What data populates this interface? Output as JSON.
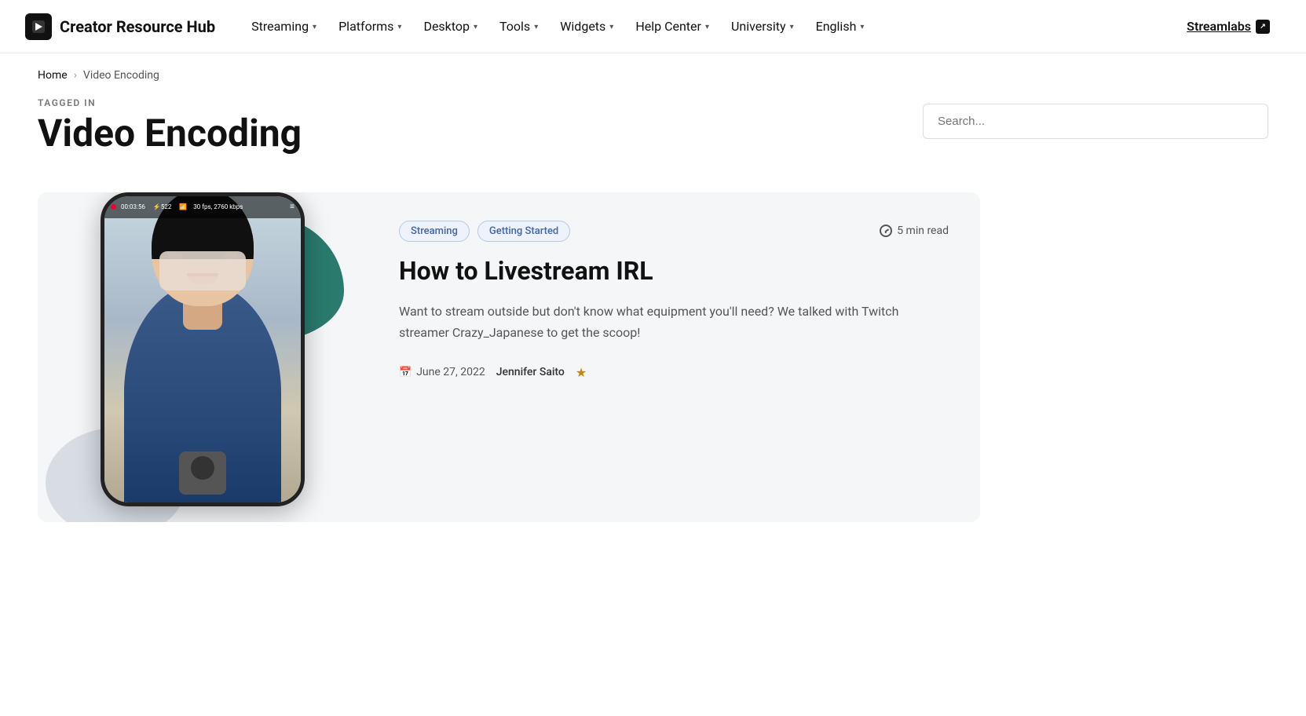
{
  "site": {
    "logo_text": "Creator Resource Hub",
    "logo_icon": "▶"
  },
  "navbar": {
    "items": [
      {
        "label": "Streaming",
        "has_dropdown": true
      },
      {
        "label": "Platforms",
        "has_dropdown": true
      },
      {
        "label": "Desktop",
        "has_dropdown": true
      },
      {
        "label": "Tools",
        "has_dropdown": true
      },
      {
        "label": "Widgets",
        "has_dropdown": true
      },
      {
        "label": "Help Center",
        "has_dropdown": true
      },
      {
        "label": "University",
        "has_dropdown": true
      },
      {
        "label": "English",
        "has_dropdown": true
      }
    ],
    "streamlabs_label": "Streamlabs",
    "streamlabs_icon": "↗"
  },
  "breadcrumb": {
    "home_label": "Home",
    "separator": "›",
    "current": "Video Encoding"
  },
  "tagged": {
    "label": "TAGGED IN",
    "title": "Video Encoding"
  },
  "search": {
    "placeholder": "Search..."
  },
  "article": {
    "tags": [
      "Streaming",
      "Getting Started"
    ],
    "read_time": "5 min read",
    "title": "How to Livestream IRL",
    "excerpt": "Want to stream outside but don't know what equipment you'll need? We talked with Twitch streamer Crazy_Japanese to get the scoop!",
    "date": "June 27, 2022",
    "author": "Jennifer Saito",
    "phone_bar_text": "00:03:56  ⚡522  📶30 fps, 2760 kbps  ≡"
  }
}
